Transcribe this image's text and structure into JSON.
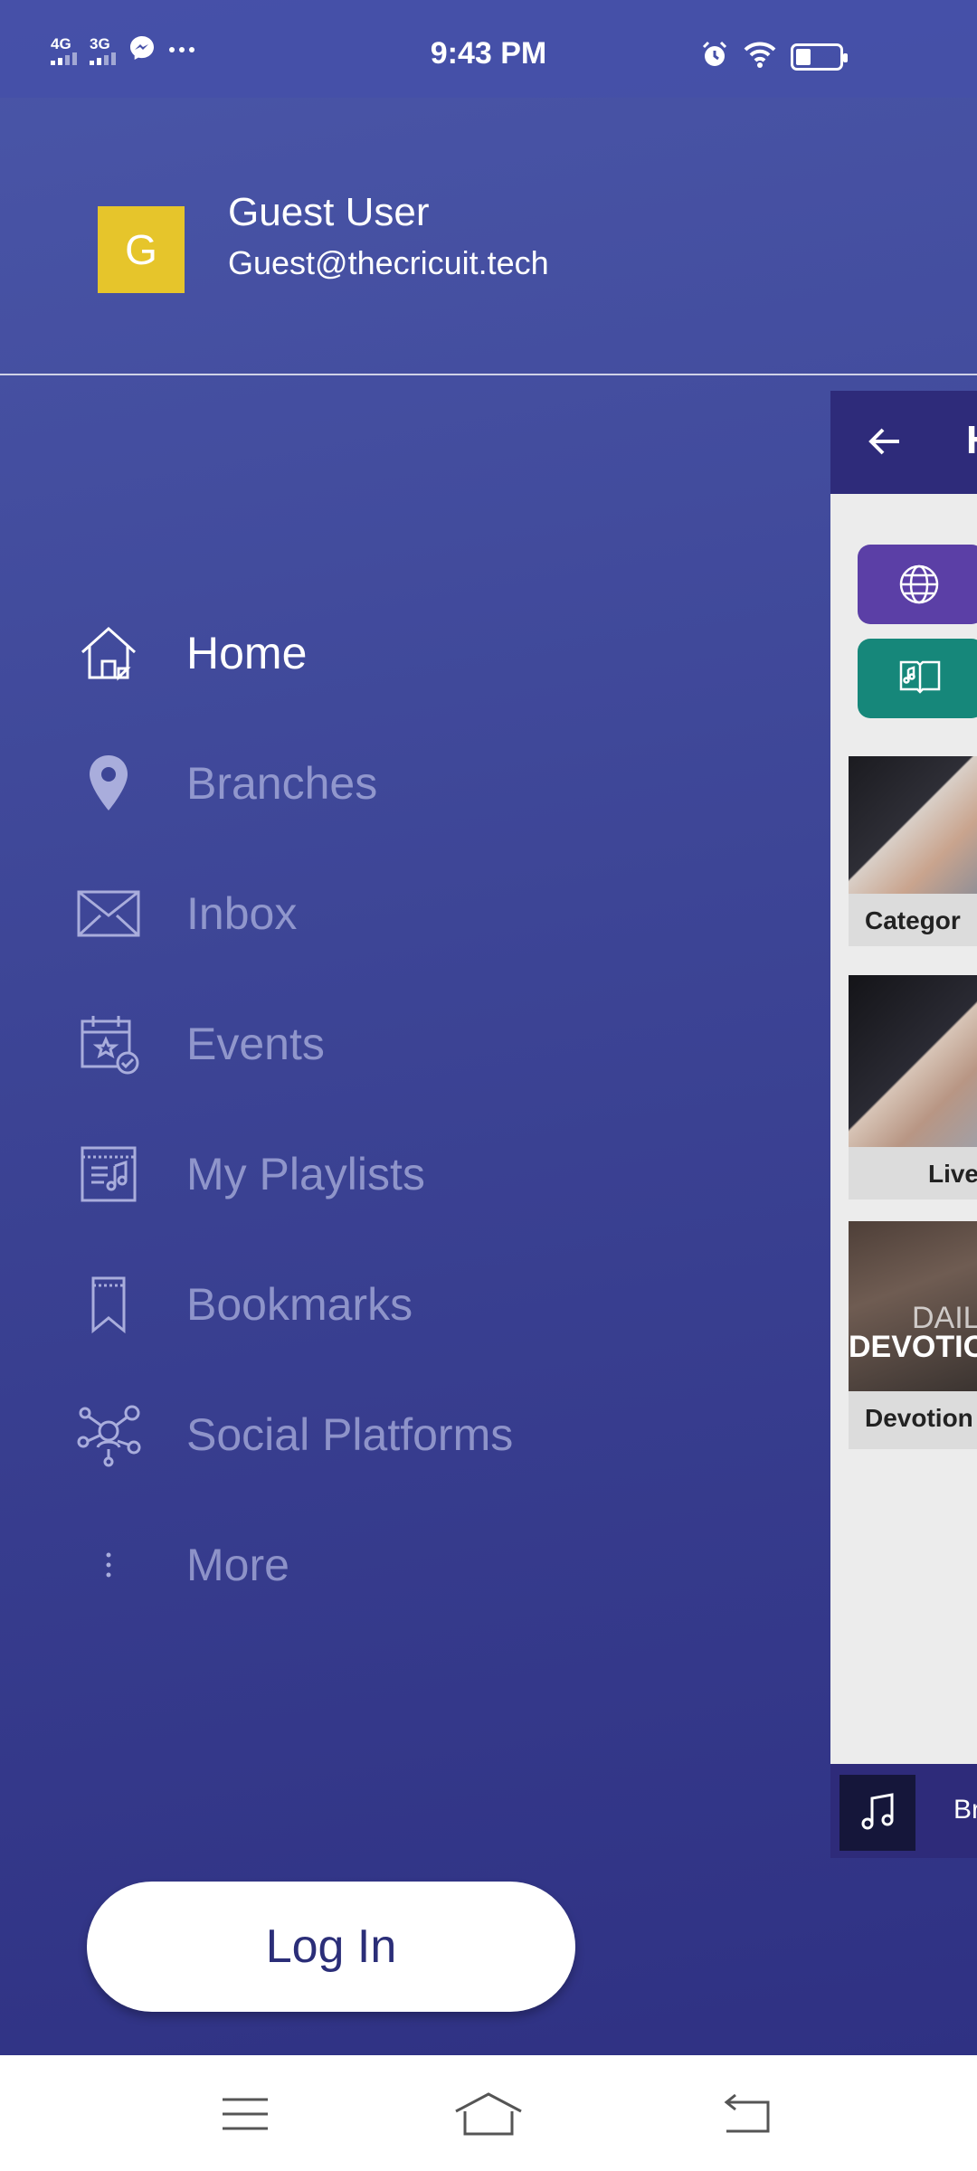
{
  "status_bar": {
    "network_1": "4G",
    "network_2": "3G",
    "time": "9:43 PM",
    "icons": [
      "signal-bars-icon",
      "messenger-icon",
      "more-dots-icon",
      "alarm-icon",
      "wifi-icon",
      "battery-icon"
    ],
    "battery_level": 0.3
  },
  "profile": {
    "avatar_letter": "G",
    "avatar_color": "#e6c52b",
    "name": "Guest User",
    "email": "Guest@thecricuit.tech"
  },
  "menu": {
    "items": [
      {
        "label": "Home",
        "icon": "home-icon",
        "active": true
      },
      {
        "label": "Branches",
        "icon": "location-pin-icon",
        "active": false
      },
      {
        "label": "Inbox",
        "icon": "envelope-icon",
        "active": false
      },
      {
        "label": "Events",
        "icon": "calendar-icon",
        "active": false
      },
      {
        "label": "My Playlists",
        "icon": "playlist-icon",
        "active": false
      },
      {
        "label": "Bookmarks",
        "icon": "bookmark-icon",
        "active": false
      },
      {
        "label": "Social Platforms",
        "icon": "social-network-icon",
        "active": false
      },
      {
        "label": "More",
        "icon": "vertical-dots-icon",
        "active": false
      }
    ]
  },
  "login": {
    "label": "Log In"
  },
  "background_app": {
    "toolbar_title_fragment": "H",
    "chips": [
      {
        "icon": "www-globe-icon",
        "color": "#5b3fa6"
      },
      {
        "icon": "music-book-icon",
        "color": "#16877a"
      }
    ],
    "cards": [
      {
        "label": "Categor"
      },
      {
        "label": "Live"
      },
      {
        "label": "Devotion",
        "overlay_line1": "DAILY",
        "overlay_line2": "DEVOTIO"
      }
    ],
    "player_text": "Br"
  },
  "colors": {
    "drawer_top": "#4a56a8",
    "drawer_bottom": "#2f3183",
    "toolbar": "#2e2b7a",
    "login_text": "#2b2e78"
  },
  "nav_bar": {
    "buttons": [
      "menu-icon",
      "home-outline-icon",
      "back-icon"
    ]
  }
}
